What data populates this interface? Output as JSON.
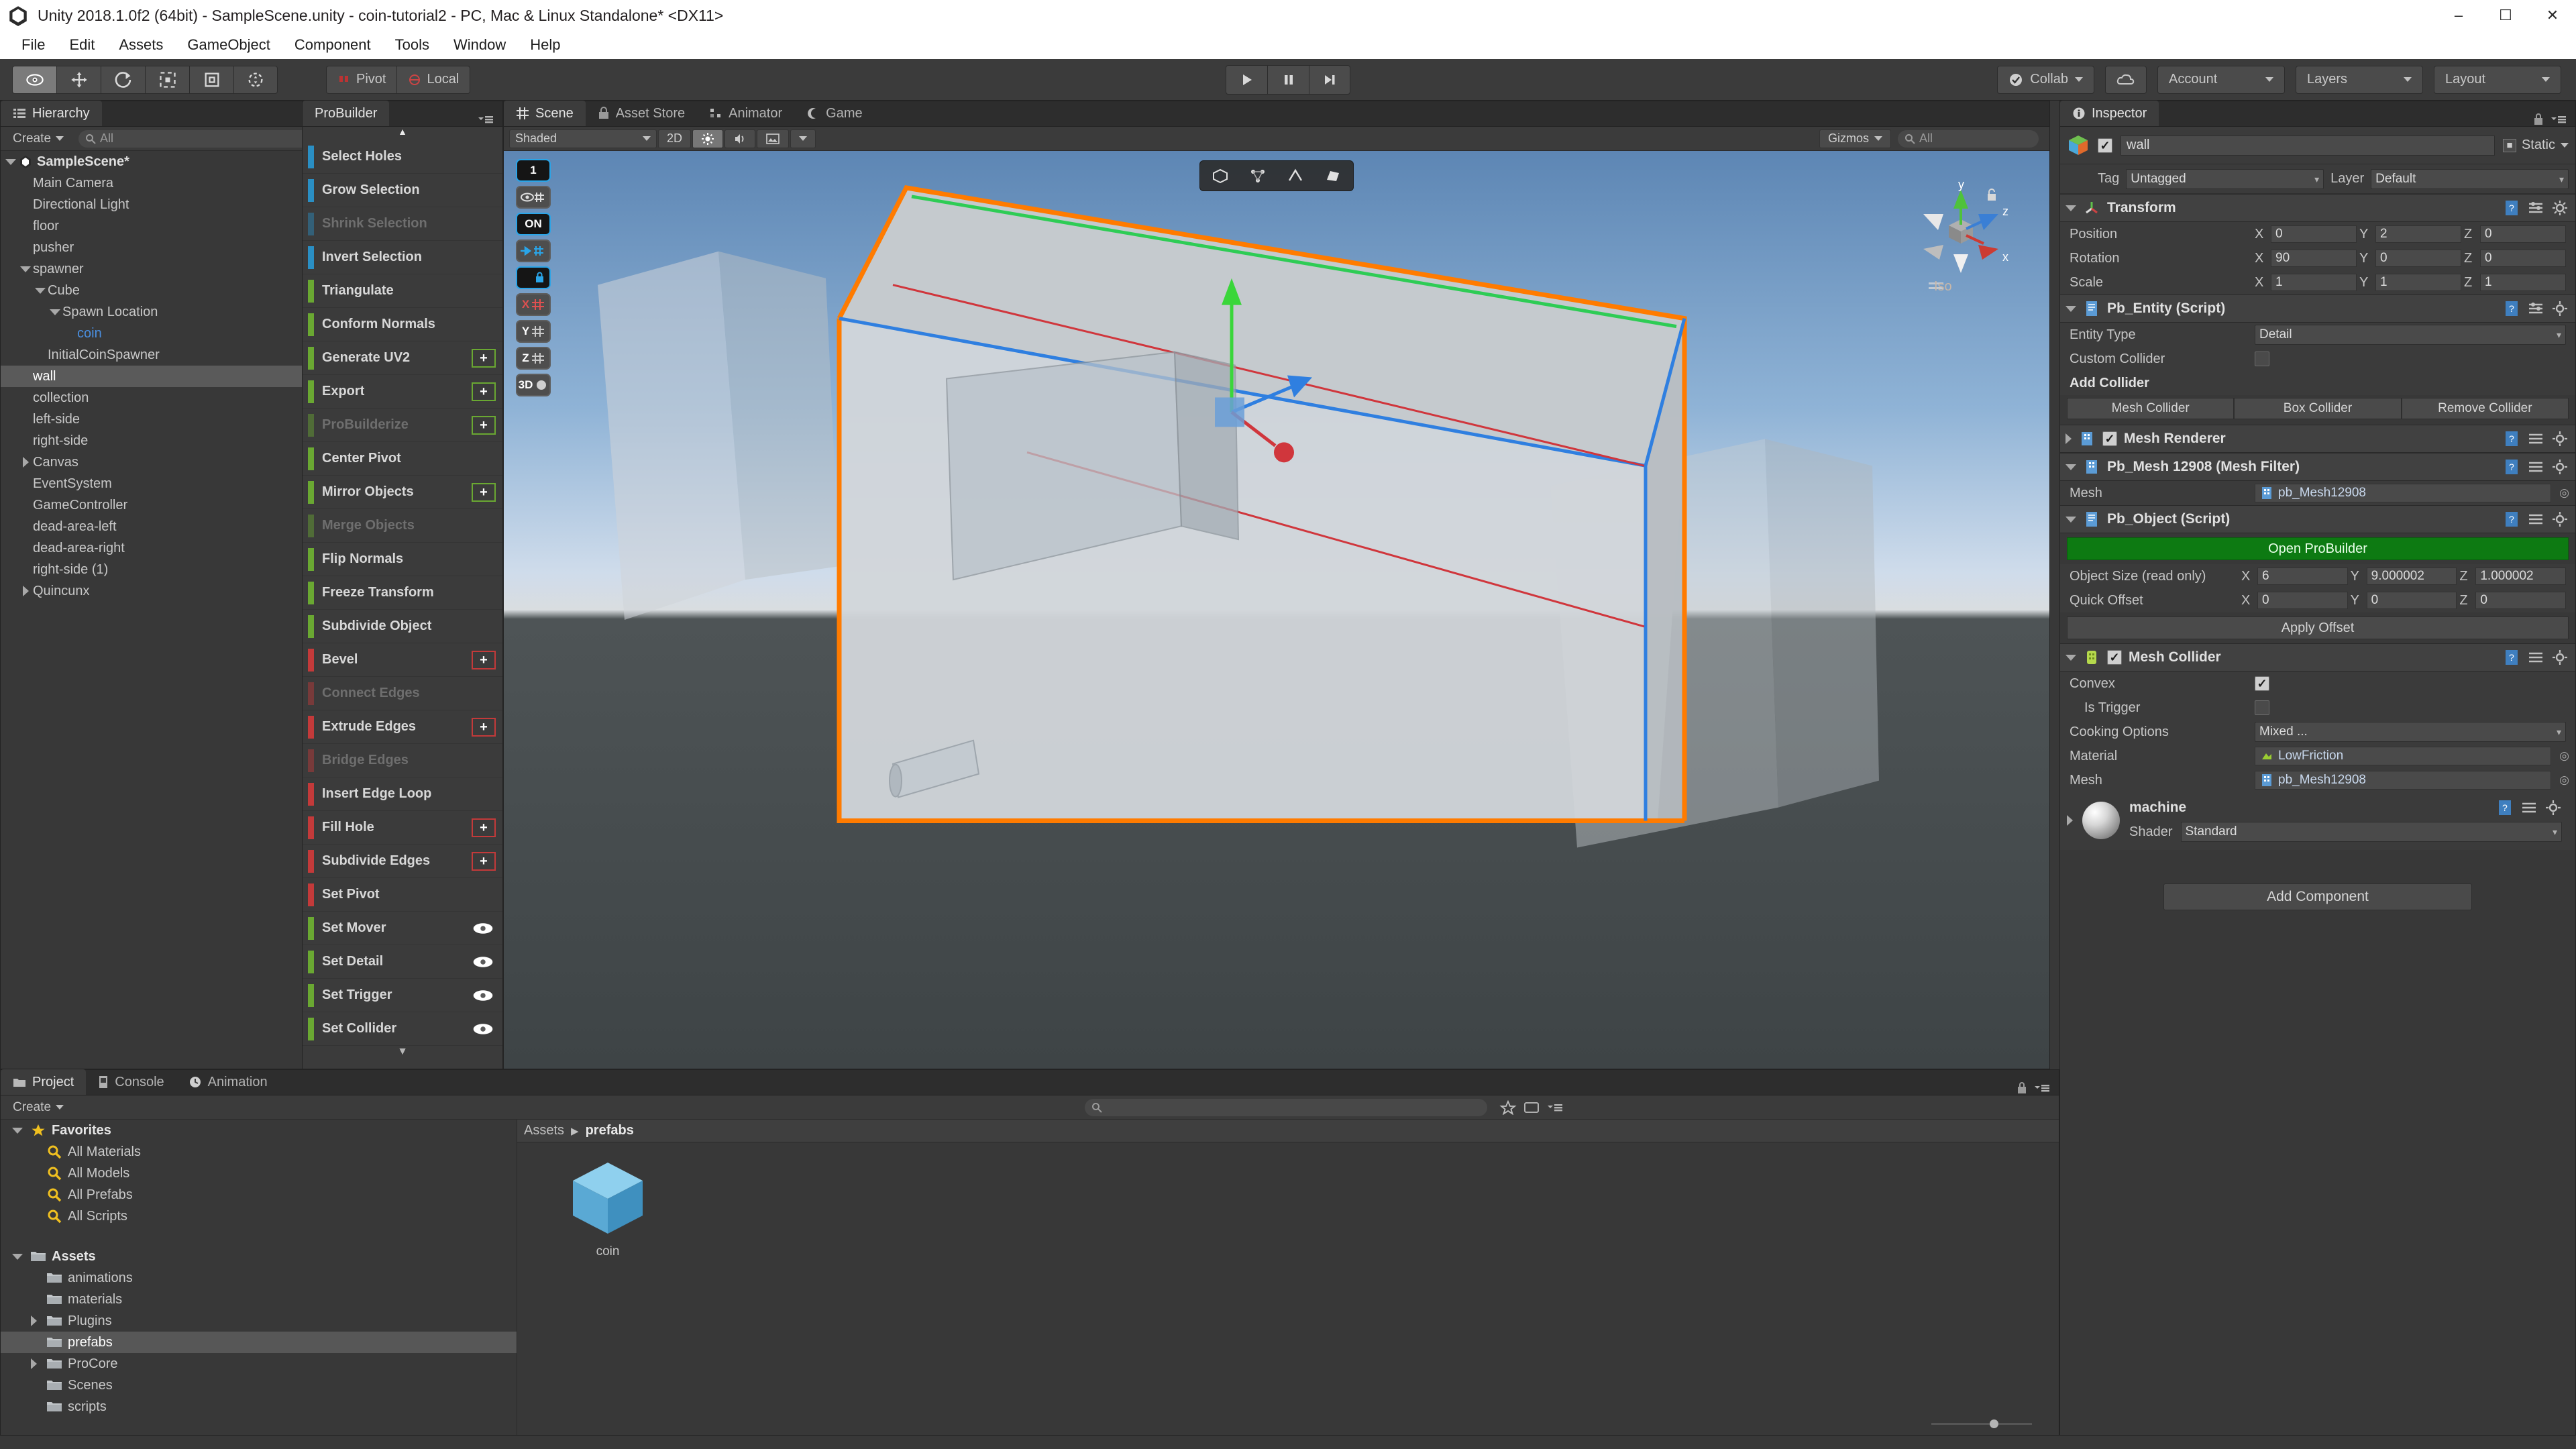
{
  "window": {
    "title": "Unity 2018.1.0f2 (64bit) - SampleScene.unity - coin-tutorial2 - PC, Mac & Linux Standalone* <DX11>",
    "minimize": "–",
    "maximize": "☐",
    "close": "✕"
  },
  "menubar": {
    "items": [
      "File",
      "Edit",
      "Assets",
      "GameObject",
      "Component",
      "Tools",
      "Window",
      "Help"
    ]
  },
  "toolbar": {
    "tools": [
      {
        "name": "hand-tool",
        "active": true
      },
      {
        "name": "move-tool",
        "active": false
      },
      {
        "name": "rotate-tool",
        "active": false
      },
      {
        "name": "scale-tool",
        "active": false
      },
      {
        "name": "rect-tool",
        "active": false
      },
      {
        "name": "transform-tool",
        "active": false
      }
    ],
    "pivot_label": "Pivot",
    "local_label": "Local",
    "play_label": "▶",
    "pause_label": "⏸",
    "step_label": "⏭",
    "collab_label": "Collab",
    "cloud_label": "",
    "account_label": "Account",
    "layers_label": "Layers",
    "layout_label": "Layout"
  },
  "hierarchy": {
    "tab_label": "Hierarchy",
    "create_label": "Create",
    "search_placeholder": "All",
    "items": [
      {
        "label": "SampleScene*",
        "depth": 0,
        "twisty": "down",
        "kind": "scene"
      },
      {
        "label": "Main Camera",
        "depth": 1,
        "twisty": "none",
        "kind": "normal"
      },
      {
        "label": "Directional Light",
        "depth": 1,
        "twisty": "none",
        "kind": "normal"
      },
      {
        "label": "floor",
        "depth": 1,
        "twisty": "none",
        "kind": "normal"
      },
      {
        "label": "pusher",
        "depth": 1,
        "twisty": "none",
        "kind": "normal"
      },
      {
        "label": "spawner",
        "depth": 1,
        "twisty": "down",
        "kind": "normal"
      },
      {
        "label": "Cube",
        "depth": 2,
        "twisty": "down",
        "kind": "normal"
      },
      {
        "label": "Spawn Location",
        "depth": 3,
        "twisty": "down",
        "kind": "normal"
      },
      {
        "label": "coin",
        "depth": 4,
        "twisty": "none",
        "kind": "prefab"
      },
      {
        "label": "InitialCoinSpawner",
        "depth": 2,
        "twisty": "none",
        "kind": "normal"
      },
      {
        "label": "wall",
        "depth": 1,
        "twisty": "none",
        "kind": "selected"
      },
      {
        "label": "collection",
        "depth": 1,
        "twisty": "none",
        "kind": "normal"
      },
      {
        "label": "left-side",
        "depth": 1,
        "twisty": "none",
        "kind": "normal"
      },
      {
        "label": "right-side",
        "depth": 1,
        "twisty": "none",
        "kind": "normal"
      },
      {
        "label": "Canvas",
        "depth": 1,
        "twisty": "right",
        "kind": "normal"
      },
      {
        "label": "EventSystem",
        "depth": 1,
        "twisty": "none",
        "kind": "normal"
      },
      {
        "label": "GameController",
        "depth": 1,
        "twisty": "none",
        "kind": "normal"
      },
      {
        "label": "dead-area-left",
        "depth": 1,
        "twisty": "none",
        "kind": "normal"
      },
      {
        "label": "dead-area-right",
        "depth": 1,
        "twisty": "none",
        "kind": "normal"
      },
      {
        "label": "right-side (1)",
        "depth": 1,
        "twisty": "none",
        "kind": "normal"
      },
      {
        "label": "Quincunx",
        "depth": 1,
        "twisty": "right",
        "kind": "normal"
      }
    ]
  },
  "probuilder": {
    "tab_label": "ProBuilder",
    "scroll_up": "▲",
    "scroll_down": "▼",
    "actions": [
      {
        "label": "Select Holes",
        "color": "#2a8fc4",
        "disabled": false,
        "plus": "none",
        "eye": false
      },
      {
        "label": "Grow Selection",
        "color": "#2a8fc4",
        "disabled": false,
        "plus": "none",
        "eye": false
      },
      {
        "label": "Shrink Selection",
        "color": "#2a8fc4",
        "disabled": true,
        "plus": "none",
        "eye": false
      },
      {
        "label": "Invert Selection",
        "color": "#2a8fc4",
        "disabled": false,
        "plus": "none",
        "eye": false
      },
      {
        "label": "Triangulate",
        "color": "#6aa832",
        "disabled": false,
        "plus": "none",
        "eye": false
      },
      {
        "label": "Conform Normals",
        "color": "#6aa832",
        "disabled": false,
        "plus": "none",
        "eye": false
      },
      {
        "label": "Generate UV2",
        "color": "#6aa832",
        "disabled": false,
        "plus": "green",
        "eye": false
      },
      {
        "label": "Export",
        "color": "#6aa832",
        "disabled": false,
        "plus": "green",
        "eye": false
      },
      {
        "label": "ProBuilderize",
        "color": "#6aa832",
        "disabled": true,
        "plus": "green",
        "eye": false
      },
      {
        "label": "Center Pivot",
        "color": "#6aa832",
        "disabled": false,
        "plus": "none",
        "eye": false
      },
      {
        "label": "Mirror Objects",
        "color": "#6aa832",
        "disabled": false,
        "plus": "green",
        "eye": false
      },
      {
        "label": "Merge Objects",
        "color": "#6aa832",
        "disabled": true,
        "plus": "none",
        "eye": false
      },
      {
        "label": "Flip Normals",
        "color": "#6aa832",
        "disabled": false,
        "plus": "none",
        "eye": false
      },
      {
        "label": "Freeze Transform",
        "color": "#6aa832",
        "disabled": false,
        "plus": "none",
        "eye": false
      },
      {
        "label": "Subdivide Object",
        "color": "#6aa832",
        "disabled": false,
        "plus": "none",
        "eye": false
      },
      {
        "label": "Bevel",
        "color": "#c33a3a",
        "disabled": false,
        "plus": "red",
        "eye": false
      },
      {
        "label": "Connect Edges",
        "color": "#c33a3a",
        "disabled": true,
        "plus": "none",
        "eye": false
      },
      {
        "label": "Extrude Edges",
        "color": "#c33a3a",
        "disabled": false,
        "plus": "red",
        "eye": false
      },
      {
        "label": "Bridge Edges",
        "color": "#c33a3a",
        "disabled": true,
        "plus": "none",
        "eye": false
      },
      {
        "label": "Insert Edge Loop",
        "color": "#c33a3a",
        "disabled": false,
        "plus": "none",
        "eye": false
      },
      {
        "label": "Fill Hole",
        "color": "#c33a3a",
        "disabled": false,
        "plus": "red",
        "eye": false
      },
      {
        "label": "Subdivide Edges",
        "color": "#c33a3a",
        "disabled": false,
        "plus": "red",
        "eye": false
      },
      {
        "label": "Set Pivot",
        "color": "#c33a3a",
        "disabled": false,
        "plus": "none",
        "eye": false
      },
      {
        "label": "Set Mover",
        "color": "#6aa832",
        "disabled": false,
        "plus": "none",
        "eye": true
      },
      {
        "label": "Set Detail",
        "color": "#6aa832",
        "disabled": false,
        "plus": "none",
        "eye": true
      },
      {
        "label": "Set Trigger",
        "color": "#6aa832",
        "disabled": false,
        "plus": "none",
        "eye": true
      },
      {
        "label": "Set Collider",
        "color": "#6aa832",
        "disabled": false,
        "plus": "none",
        "eye": true
      }
    ]
  },
  "scene": {
    "tabs": [
      {
        "label": "Scene",
        "active": true,
        "icon": "grid-icon"
      },
      {
        "label": "Asset Store",
        "active": false,
        "icon": "store-icon"
      },
      {
        "label": "Animator",
        "active": false,
        "icon": "animator-icon"
      },
      {
        "label": "Game",
        "active": false,
        "icon": "game-icon"
      }
    ],
    "shading_mode": "Shaded",
    "mode_2d": "2D",
    "gizmos_label": "Gizmos",
    "gizmos_search_placeholder": "All",
    "compass": {
      "x": "x",
      "y": "y",
      "z": "z",
      "projection": "Iso"
    },
    "progrids": [
      {
        "label": "1",
        "style": "dark"
      },
      {
        "label": "",
        "style": "grey",
        "icon": "eye-grid-icon"
      },
      {
        "label": "ON",
        "style": "dark"
      },
      {
        "label": "",
        "style": "grey",
        "icon": "arrow-grid-icon"
      },
      {
        "label": "",
        "style": "dark",
        "icon": "lock-grid-icon"
      },
      {
        "label": "X",
        "style": "grey"
      },
      {
        "label": "Y",
        "style": "grey"
      },
      {
        "label": "Z",
        "style": "grey"
      },
      {
        "label": "3D",
        "style": "grey"
      }
    ]
  },
  "inspector": {
    "tab_label": "Inspector",
    "object_name": "wall",
    "object_enabled": true,
    "static_label": "Static",
    "tag_label": "Tag",
    "tag_value": "Untagged",
    "layer_label": "Layer",
    "layer_value": "Default",
    "components": {
      "transform": {
        "title": "Transform",
        "position_label": "Position",
        "position": {
          "x": "0",
          "y": "2",
          "z": "0"
        },
        "rotation_label": "Rotation",
        "rotation": {
          "x": "90",
          "y": "0",
          "z": "0"
        },
        "scale_label": "Scale",
        "scale": {
          "x": "1",
          "y": "1",
          "z": "1"
        }
      },
      "pb_entity": {
        "title": "Pb_Entity (Script)",
        "entity_type_label": "Entity Type",
        "entity_type_value": "Detail",
        "custom_collider_label": "Custom Collider",
        "custom_collider_checked": false,
        "add_collider_label": "Add Collider",
        "buttons": [
          "Mesh Collider",
          "Box Collider",
          "Remove Collider"
        ]
      },
      "mesh_renderer": {
        "title": "Mesh Renderer",
        "enabled": true
      },
      "mesh_filter": {
        "title": "Pb_Mesh 12908 (Mesh Filter)",
        "mesh_label": "Mesh",
        "mesh_value": "pb_Mesh12908"
      },
      "pb_object": {
        "title": "Pb_Object (Script)",
        "open_probuilder_label": "Open ProBuilder",
        "object_size_label": "Object Size (read only)",
        "object_size": {
          "x": "6",
          "y": "9.000002",
          "z": "1.000002"
        },
        "quick_offset_label": "Quick Offset",
        "quick_offset": {
          "x": "0",
          "y": "0",
          "z": "0"
        },
        "apply_offset_label": "Apply Offset"
      },
      "mesh_collider": {
        "title": "Mesh Collider",
        "enabled": true,
        "convex_label": "Convex",
        "convex_checked": true,
        "is_trigger_label": "Is Trigger",
        "is_trigger_checked": false,
        "cooking_options_label": "Cooking Options",
        "cooking_options_value": "Mixed ...",
        "material_label": "Material",
        "material_value": "LowFriction",
        "mesh_label": "Mesh",
        "mesh_value": "pb_Mesh12908"
      },
      "material": {
        "name": "machine",
        "shader_label": "Shader",
        "shader_value": "Standard"
      }
    },
    "add_component_label": "Add Component"
  },
  "project": {
    "tabs": [
      {
        "label": "Project",
        "active": true,
        "icon": "project-icon"
      },
      {
        "label": "Console",
        "active": false,
        "icon": "console-icon"
      },
      {
        "label": "Animation",
        "active": false,
        "icon": "animation-icon"
      }
    ],
    "create_label": "Create",
    "search_placeholder": "",
    "tree": [
      {
        "label": "Favorites",
        "depth": 0,
        "twisty": "down",
        "icon": "star-icon",
        "kind": "head"
      },
      {
        "label": "All Materials",
        "depth": 1,
        "twisty": "none",
        "icon": "search-icon",
        "kind": "normal"
      },
      {
        "label": "All Models",
        "depth": 1,
        "twisty": "none",
        "icon": "search-icon",
        "kind": "normal"
      },
      {
        "label": "All Prefabs",
        "depth": 1,
        "twisty": "none",
        "icon": "search-icon",
        "kind": "normal"
      },
      {
        "label": "All Scripts",
        "depth": 1,
        "twisty": "none",
        "icon": "search-icon",
        "kind": "normal"
      },
      {
        "label": "",
        "depth": 0,
        "twisty": "none",
        "icon": "none",
        "kind": "spacer"
      },
      {
        "label": "Assets",
        "depth": 0,
        "twisty": "down",
        "icon": "folder-icon",
        "kind": "head"
      },
      {
        "label": "animations",
        "depth": 1,
        "twisty": "none",
        "icon": "folder-icon",
        "kind": "normal"
      },
      {
        "label": "materials",
        "depth": 1,
        "twisty": "none",
        "icon": "folder-icon",
        "kind": "normal"
      },
      {
        "label": "Plugins",
        "depth": 1,
        "twisty": "right",
        "icon": "folder-icon",
        "kind": "normal"
      },
      {
        "label": "prefabs",
        "depth": 1,
        "twisty": "none",
        "icon": "folder-icon",
        "kind": "selected"
      },
      {
        "label": "ProCore",
        "depth": 1,
        "twisty": "right",
        "icon": "folder-icon",
        "kind": "normal"
      },
      {
        "label": "Scenes",
        "depth": 1,
        "twisty": "none",
        "icon": "folder-icon",
        "kind": "normal"
      },
      {
        "label": "scripts",
        "depth": 1,
        "twisty": "none",
        "icon": "folder-icon",
        "kind": "normal"
      }
    ],
    "breadcrumb": {
      "root": "Assets",
      "sep": "▶",
      "current": "prefabs"
    },
    "assets": [
      {
        "label": "coin",
        "icon": "cube-prefab-icon"
      }
    ]
  }
}
